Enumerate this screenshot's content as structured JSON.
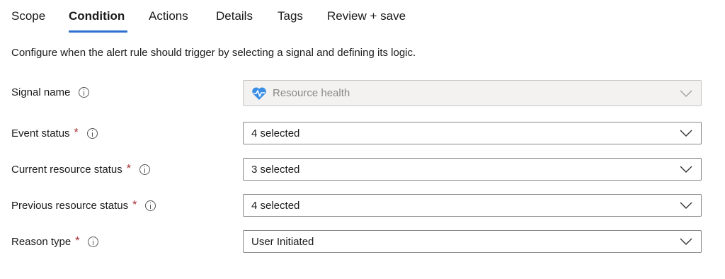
{
  "tabs": [
    {
      "label": "Scope",
      "active": false
    },
    {
      "label": "Condition",
      "active": true
    },
    {
      "label": "Actions",
      "active": false
    },
    {
      "label": "Details",
      "active": false
    },
    {
      "label": "Tags",
      "active": false
    },
    {
      "label": "Review + save",
      "active": false
    }
  ],
  "description": "Configure when the alert rule should trigger by selecting a signal and defining its logic.",
  "fields": [
    {
      "label": "Signal name",
      "required": false,
      "value": "Resource health",
      "disabled": true,
      "icon": "heart-pulse-icon"
    },
    {
      "label": "Event status",
      "required": true,
      "value": "4 selected",
      "disabled": false
    },
    {
      "label": "Current resource status",
      "required": true,
      "value": "3 selected",
      "disabled": false
    },
    {
      "label": "Previous resource status",
      "required": true,
      "value": "4 selected",
      "disabled": false
    },
    {
      "label": "Reason type",
      "required": true,
      "value": "User Initiated",
      "disabled": false
    }
  ],
  "required_marker": "*",
  "colors": {
    "accent": "#2f6fd0",
    "required": "#a4262c",
    "heart": "#3a8ee6"
  }
}
